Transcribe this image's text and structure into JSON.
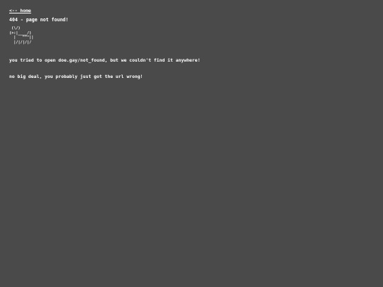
{
  "nav": {
    "home_label": "<-- home"
  },
  "error": {
    "title": "404 - page not found!",
    "ascii_art": " (\\/)\n(>:|____/)\n  |   \"\"\"||\n  |/|/|/|/",
    "message_line1": "you tried to open doe.gay/not_found, but we couldn't find it anywhere!",
    "message_line2": "no big deal, you probably just got the url wrong!"
  }
}
